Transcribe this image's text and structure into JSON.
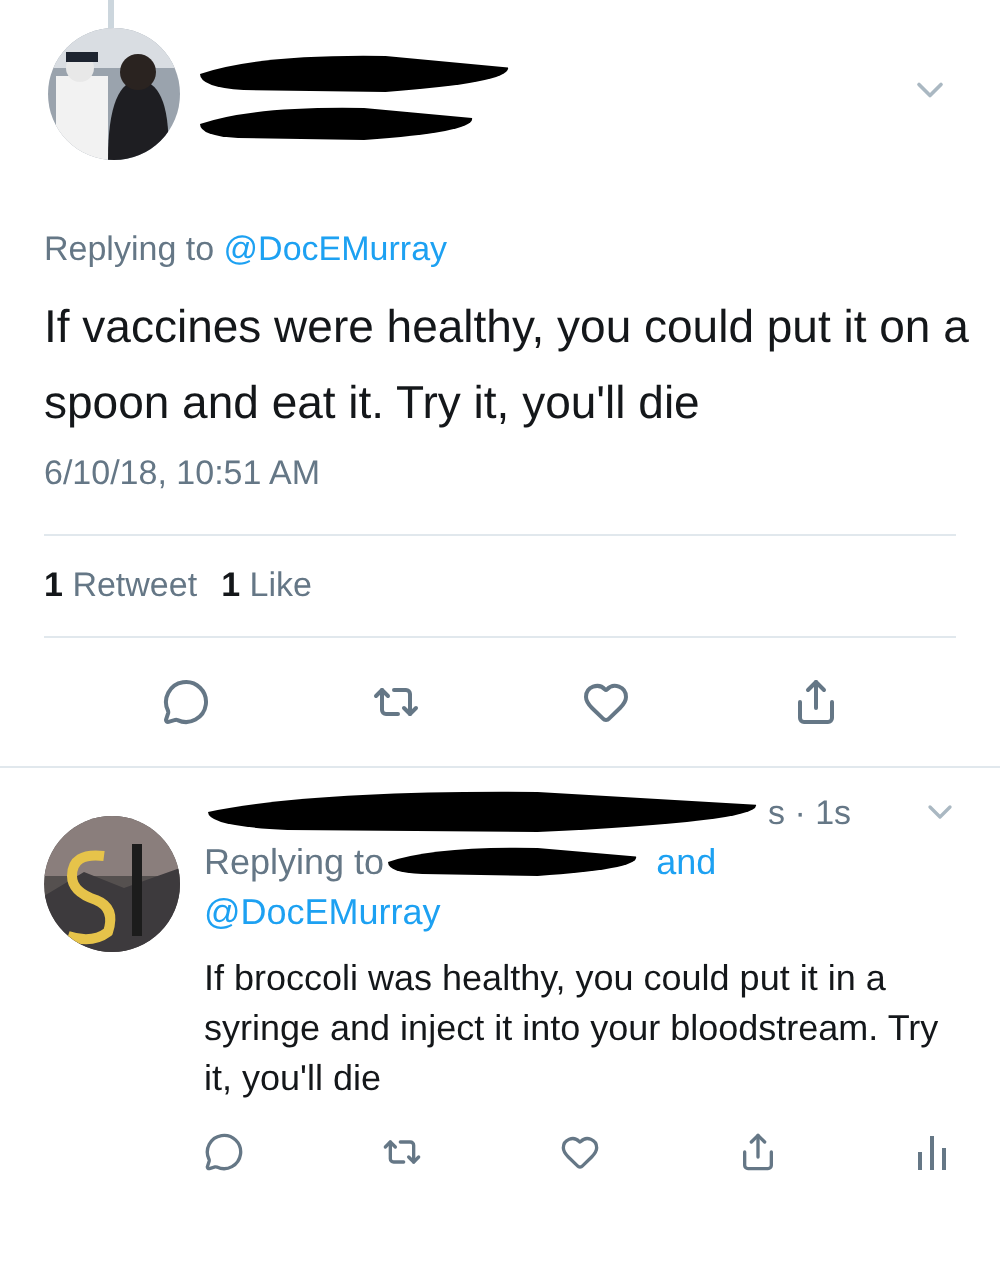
{
  "main_tweet": {
    "replying_to": "Replying to",
    "mention": "@DocEMurray",
    "text": "If vaccines were healthy, you could put it on a spoon and eat it. Try it, you'll die",
    "timestamp": "6/10/18, 10:51 AM",
    "retweets": {
      "count": "1",
      "label": "Retweet"
    },
    "likes": {
      "count": "1",
      "label": "Like"
    }
  },
  "reply": {
    "time": "s · 1s",
    "replying_to": "Replying to",
    "and": "and",
    "mention": "@DocEMurray",
    "text": "If broccoli was healthy, you could put it in a syringe and inject it into your bloodstream. Try it, you'll die"
  }
}
